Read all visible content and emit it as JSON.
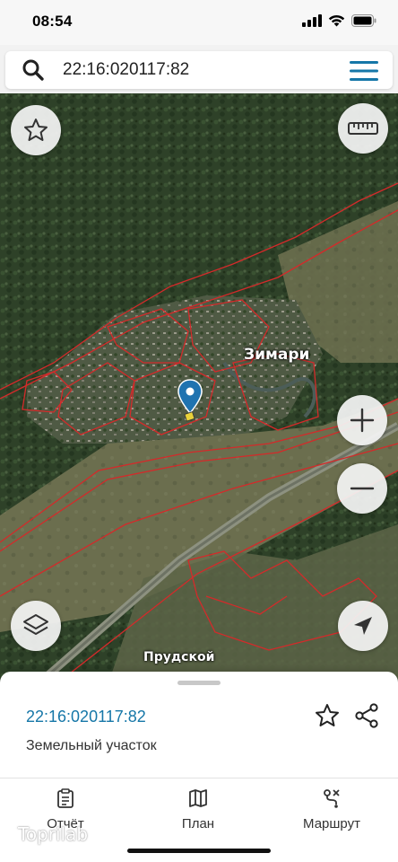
{
  "status_bar": {
    "time": "08:54"
  },
  "search": {
    "value": "22:16:020117:82"
  },
  "map": {
    "labels": {
      "village_main": "Зимари",
      "village_south": "Прудской"
    }
  },
  "parcel": {
    "cadastral_number": "22:16:020117:82",
    "type": "Земельный участок"
  },
  "tabs": [
    {
      "label": "Отчёт",
      "icon": "report-icon"
    },
    {
      "label": "План",
      "icon": "map-plan-icon"
    },
    {
      "label": "Маршрут",
      "icon": "route-icon"
    }
  ],
  "watermark": "Toprilab",
  "colors": {
    "accent": "#1677a8",
    "boundary": "#d42a2a",
    "marker": "#1f73b0"
  }
}
